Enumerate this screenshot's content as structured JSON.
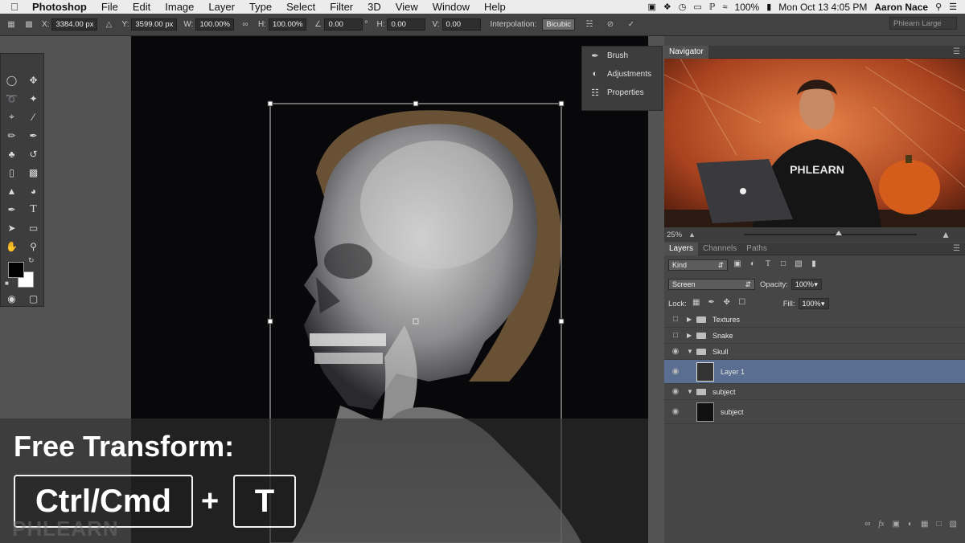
{
  "menubar": {
    "apple": "",
    "app": "Photoshop",
    "items": [
      "File",
      "Edit",
      "Image",
      "Layer",
      "Type",
      "Select",
      "Filter",
      "3D",
      "View",
      "Window",
      "Help"
    ],
    "battery": "100%",
    "clock": "Mon Oct 13  4:05 PM",
    "user": "Aaron Nace"
  },
  "options": {
    "x_label": "X:",
    "x_value": "3384.00 px",
    "y_label": "Y:",
    "y_value": "3599.00 px",
    "w_label": "W:",
    "w_value": "100.00%",
    "h_label": "H:",
    "h_value": "100.00%",
    "angle_value": "0.00",
    "angle_unit": "°",
    "hskew_label": "H:",
    "hskew_value": "0.00",
    "vskew_label": "V:",
    "vskew_value": "0.00",
    "interpolation_label": "Interpolation:",
    "interpolation_value": "Bicubic",
    "workspace": "Phlearn Large"
  },
  "mini_panel": {
    "items": [
      "Brush",
      "Adjustments",
      "Properties"
    ]
  },
  "navigator": {
    "tab": "Navigator",
    "zoom": "25%",
    "zoom_slider_fraction": 0.55
  },
  "layers_panel": {
    "tabs": [
      "Layers",
      "Channels",
      "Paths"
    ],
    "filter_kind": "Kind",
    "blend_mode": "Screen",
    "opacity_label": "Opacity:",
    "opacity_value": "100%",
    "lock_label": "Lock:",
    "fill_label": "Fill:",
    "fill_value": "100%",
    "layers": [
      {
        "name": "Textures",
        "type": "group",
        "visible": false,
        "expanded": false,
        "indent": 0
      },
      {
        "name": "Snake",
        "type": "group",
        "visible": false,
        "expanded": false,
        "indent": 0
      },
      {
        "name": "Skull",
        "type": "group",
        "visible": true,
        "expanded": true,
        "indent": 0
      },
      {
        "name": "Layer 1",
        "type": "layer",
        "visible": true,
        "selected": true,
        "indent": 1
      },
      {
        "name": "subject",
        "type": "group",
        "visible": true,
        "expanded": true,
        "indent": 0
      },
      {
        "name": "subject",
        "type": "layer",
        "visible": true,
        "indent": 1
      }
    ]
  },
  "overlay": {
    "title": "Free Transform:",
    "key1": "Ctrl/Cmd",
    "plus": "+",
    "key2": "T",
    "watermark": "PHLEARN"
  },
  "nav_shirt_text": "PHLEARN"
}
